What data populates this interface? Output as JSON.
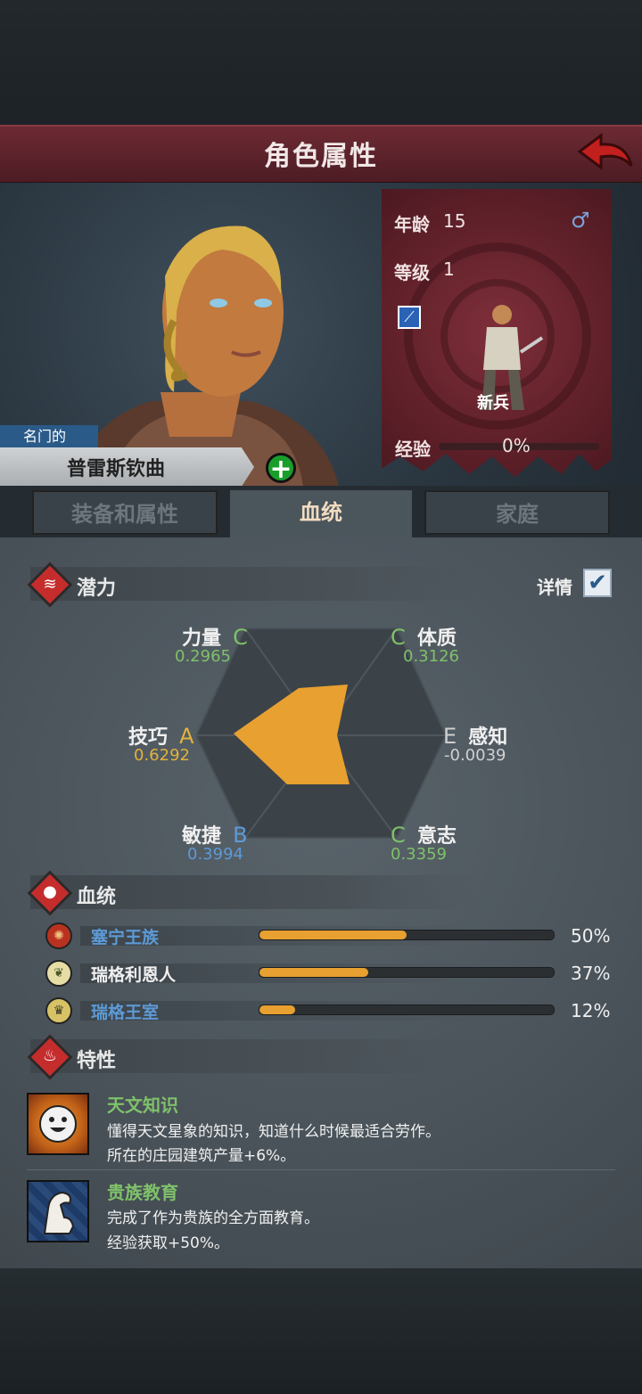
{
  "header": {
    "title": "角色属性"
  },
  "character": {
    "name_prefix": "名门的",
    "name": "普雷斯钦曲"
  },
  "info": {
    "age_label": "年龄",
    "age": "15",
    "gender_symbol": "♂",
    "level_label": "等级",
    "level": "1",
    "class_name": "新兵",
    "exp_label": "经验",
    "exp_pct": "0%",
    "exp_fraction": 0
  },
  "tabs": [
    {
      "label": "装备和属性",
      "active": false
    },
    {
      "label": "血统",
      "active": true
    },
    {
      "label": "家庭",
      "active": false
    }
  ],
  "potential": {
    "title": "潜力",
    "detail_label": "详情",
    "detail_checked": true,
    "stats": [
      {
        "name": "力量",
        "grade": "C",
        "value": "0.2965",
        "color": "#7fc16a"
      },
      {
        "name": "体质",
        "grade": "C",
        "value": "0.3126",
        "color": "#7fc16a"
      },
      {
        "name": "技巧",
        "grade": "A",
        "value": "0.6292",
        "color": "#e3b23c"
      },
      {
        "name": "感知",
        "grade": "E",
        "value": "-0.0039",
        "color": "#d0d0d0"
      },
      {
        "name": "敏捷",
        "grade": "B",
        "value": "0.3994",
        "color": "#5d9ad6"
      },
      {
        "name": "意志",
        "grade": "C",
        "value": "0.3359",
        "color": "#7fc16a"
      }
    ]
  },
  "lineage": {
    "title": "血统",
    "items": [
      {
        "name": "塞宁王族",
        "pct": "50%",
        "fraction": 0.5,
        "name_color": "#5d9ad6",
        "icon": "crimson-sun-emblem-icon"
      },
      {
        "name": "瑞格利恩人",
        "pct": "37%",
        "fraction": 0.37,
        "name_color": "#f0f0f0",
        "icon": "leaf-emblem-icon"
      },
      {
        "name": "瑞格王室",
        "pct": "12%",
        "fraction": 0.12,
        "name_color": "#5d9ad6",
        "icon": "crown-emblem-icon"
      }
    ]
  },
  "traits": {
    "title": "特性",
    "items": [
      {
        "name": "天文知识",
        "desc1": "懂得天文星象的知识，知道什么时候最适合劳作。",
        "desc2": "所在的庄园建筑产量+6%。",
        "icon": "sun-face-icon"
      },
      {
        "name": "贵族教育",
        "desc1": "完成了作为贵族的全方面教育。",
        "desc2": "经验获取+50%。",
        "icon": "flexed-arm-icon"
      }
    ]
  },
  "colors": {
    "accent_red": "#c52d2d",
    "radar_fill": "#e8a030",
    "trait_green": "#7fc16a"
  }
}
